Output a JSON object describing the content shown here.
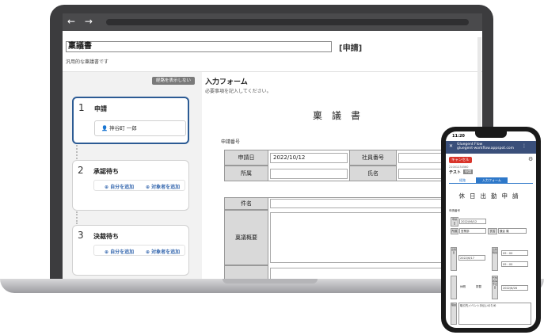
{
  "browser": {
    "nav_arrows": "← →"
  },
  "app": {
    "title_value": "稟議書",
    "title_status": "[申請]",
    "description": "汎用的な稟議書です",
    "hide_button": "経路を表示しない"
  },
  "steps": [
    {
      "number": "1",
      "title": "申請",
      "assignee": "神谷町 一郎"
    },
    {
      "number": "2",
      "title": "承認待ち",
      "add_self": "⊕ 自分を追加",
      "add_target": "⊕ 対象者を追加"
    },
    {
      "number": "3",
      "title": "決裁待ち",
      "add_self": "⊕ 自分を追加",
      "add_target": "⊕ 対象者を追加"
    }
  ],
  "form": {
    "heading": "入力フォーム",
    "subtitle": "必要事項を記入してください。",
    "doc_title": "稟議書",
    "application_no_label": "申請番号",
    "fields": {
      "apply_date_label": "申請日",
      "apply_date_value": "2022/10/12",
      "employee_no_label": "社員番号",
      "department_label": "所属",
      "name_label": "氏名",
      "subject_label": "件名",
      "summary_label": "稟議概要"
    }
  },
  "phone": {
    "time": "11:20",
    "header_title": "Gluegent Flow",
    "header_url": "gluegent-workflow.appspot.com",
    "cancel_label": "キャンセル",
    "meta": "21001234560",
    "user_name": "テスト",
    "badge": "申請",
    "tab1": "経路",
    "tab2": "入力フォーム",
    "doc_title": "休日出勤申請",
    "app_no_label": "申請番号",
    "apply_date_label": "申請日",
    "apply_date_value": "2022/06/12",
    "dept_label": "所属",
    "dept_value": "営業部",
    "name_label": "氏名",
    "name_value": "鎌倉 隆",
    "work_date_label": "出勤日",
    "work_date_value": "2022/6/17",
    "start_label": "出勤時間",
    "hh_placeholder": "09 : 00",
    "comp_label": "代休取得予定日",
    "comp_value": "2022/6/26",
    "reason_label": "理由",
    "reason_value": "取引先イベント手伝いのため",
    "choice1": "休暇",
    "choice2": "振替"
  },
  "colors": {
    "accent": "#2c5b94",
    "phone_header": "#3a4f7a",
    "cancel": "#d9352b",
    "tab": "#2e78c9"
  }
}
